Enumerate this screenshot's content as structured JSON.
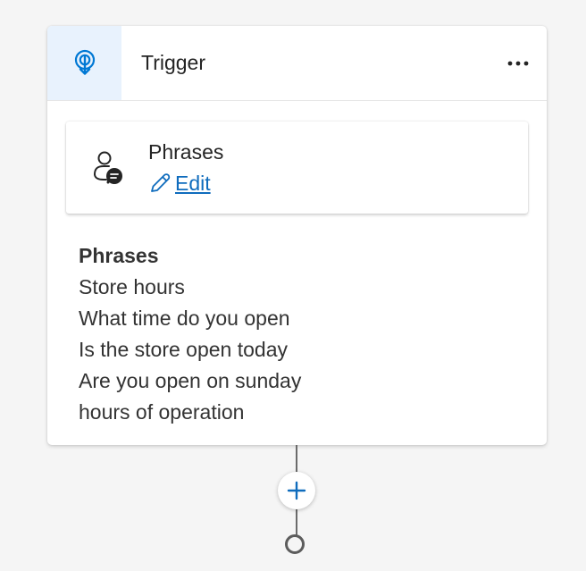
{
  "trigger_card": {
    "title": "Trigger",
    "icon": "trigger-icon",
    "more_icon": "more-horizontal-icon"
  },
  "phrases_box": {
    "title": "Phrases",
    "edit_label": "Edit",
    "person_icon": "person-chat-icon",
    "edit_icon": "pencil-icon"
  },
  "content": {
    "heading": "Phrases",
    "phrases": [
      "Store hours",
      "What time do you open",
      "Is the store open today",
      "Are you open on sunday",
      "hours of operation"
    ]
  },
  "add_node": {
    "icon": "plus-icon"
  },
  "colors": {
    "accent": "#0f6cbd",
    "icon_blue": "#0078d4",
    "icon_box": "#e8f2fd",
    "background": "#f5f5f5"
  }
}
